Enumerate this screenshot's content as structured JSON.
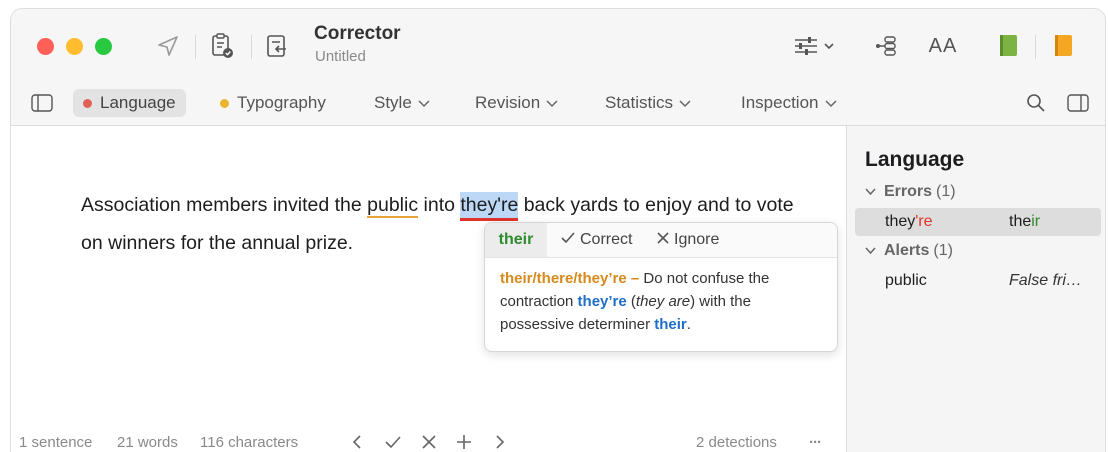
{
  "app": {
    "title": "Corrector",
    "subtitle": "Untitled"
  },
  "toolbar_icons": [
    "send-icon",
    "checklist-icon",
    "import-icon",
    "sliders-icon",
    "outline-icon",
    "font-size-icon",
    "green-book-icon",
    "orange-book-icon"
  ],
  "font_size_label": "AA",
  "tabs": [
    {
      "label": "Language",
      "dot_color": "#e06058",
      "active": true
    },
    {
      "label": "Typography",
      "dot_color": "#e9b52e",
      "active": false
    },
    {
      "label": "Style",
      "active": false
    },
    {
      "label": "Revision",
      "active": false
    },
    {
      "label": "Statistics",
      "active": false
    },
    {
      "label": "Inspection",
      "active": false
    }
  ],
  "document": {
    "p1": "Association members invited the ",
    "w_public": "public",
    "p2": " into ",
    "w_theyre": "they're",
    "p3": " back yards to enjoy and to vote on winners for the annual prize."
  },
  "popover": {
    "suggestion": "their",
    "correct_label": "Correct",
    "ignore_label": "Ignore",
    "rule": "their/there/they’re –",
    "text1": " Do not confuse the contraction ",
    "term1": "they’re",
    "text2": " (",
    "term1_gloss": "they are",
    "text3": ") with the possessive determiner ",
    "term2": "their",
    "text4": "."
  },
  "status": {
    "sentences": "1 sentence",
    "words": "21 words",
    "characters": "116 characters",
    "detections": "2 detections",
    "more": "···"
  },
  "sidebar": {
    "title": "Language",
    "errors_label": "Errors",
    "errors_count": "(1)",
    "error_item": {
      "word_a": "they",
      "word_b": "'re",
      "fix_a": "the",
      "fix_b": "ir"
    },
    "alerts_label": "Alerts",
    "alerts_count": "(1)",
    "alert_item": {
      "word": "public",
      "note": "False fri…"
    }
  },
  "colors": {
    "error_red": "#e0342b",
    "alert_orange": "#e8a33a",
    "selection_blue": "#bcd8f6",
    "fix_green": "#2e8b2e",
    "link_blue": "#1f6fc9"
  }
}
